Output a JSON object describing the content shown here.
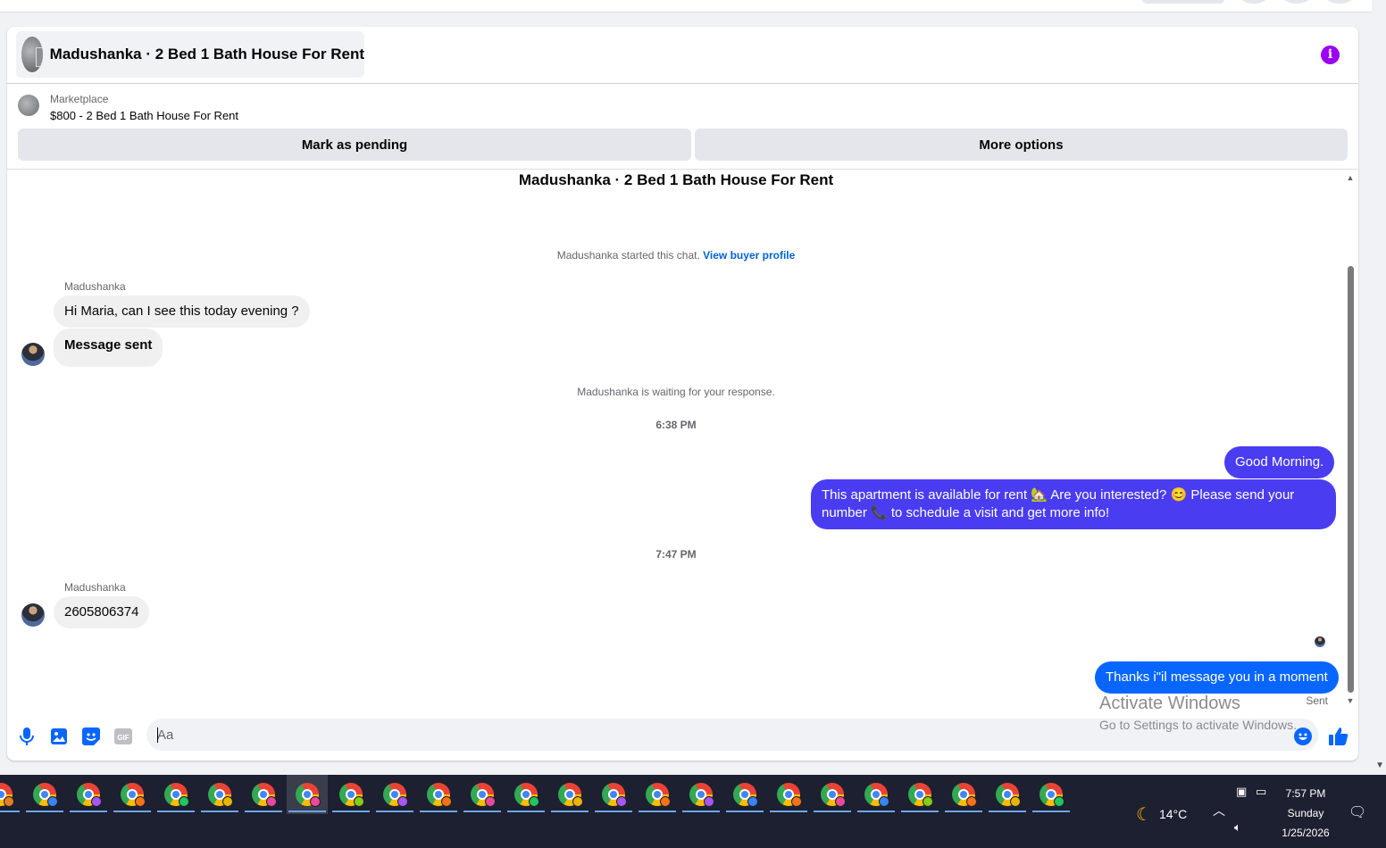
{
  "header": {
    "title": "Madushanka · 2 Bed 1 Bath House For Rent"
  },
  "listing": {
    "source_label": "Marketplace",
    "price_title": "$800 - 2 Bed 1 Bath House For Rent",
    "mark_pending_label": "Mark as pending",
    "more_options_label": "More options"
  },
  "chat": {
    "title": "Madushanka · 2 Bed 1 Bath House For Rent",
    "started_text": "Madushanka started this chat.",
    "view_profile_label": "View buyer profile",
    "waiting_text": "Madushanka is waiting for your response.",
    "messages": [
      {
        "sender": "Madushanka",
        "text": "Hi Maria, can I see this today evening ?"
      },
      {
        "text": "Message sent"
      },
      {
        "time": "6:38 PM"
      },
      {
        "text": "Good Morning."
      },
      {
        "text_line1": "This apartment is available for rent 🏡 Are you interested? 😊 Please send your",
        "text_line2": "number 📞 to schedule a visit and get more info!"
      },
      {
        "time": "7:47 PM"
      },
      {
        "sender": "Madushanka",
        "text": "2605806374"
      },
      {
        "text": "Thanks i\"il message you in a moment"
      }
    ],
    "sent_status": "Sent"
  },
  "composer": {
    "placeholder": "Aa",
    "icons": [
      "microphone-icon",
      "image-icon",
      "sticker-icon",
      "gif-icon",
      "emoji-icon",
      "thumbs-up-icon"
    ],
    "gif_text": "GIF"
  },
  "watermark": {
    "line1": "Activate Windows",
    "line2": "Go to Settings to activate Windows."
  },
  "taskbar": {
    "temperature": "14°C",
    "time": "7:57 PM",
    "day": "Sunday",
    "date": "1/25/2026"
  },
  "colors": {
    "accent_purple": "#9b00f5",
    "outgoing_bubble": "#4a3cf0",
    "outgoing_latest": "#0866ff",
    "link_blue": "#0064d1"
  }
}
